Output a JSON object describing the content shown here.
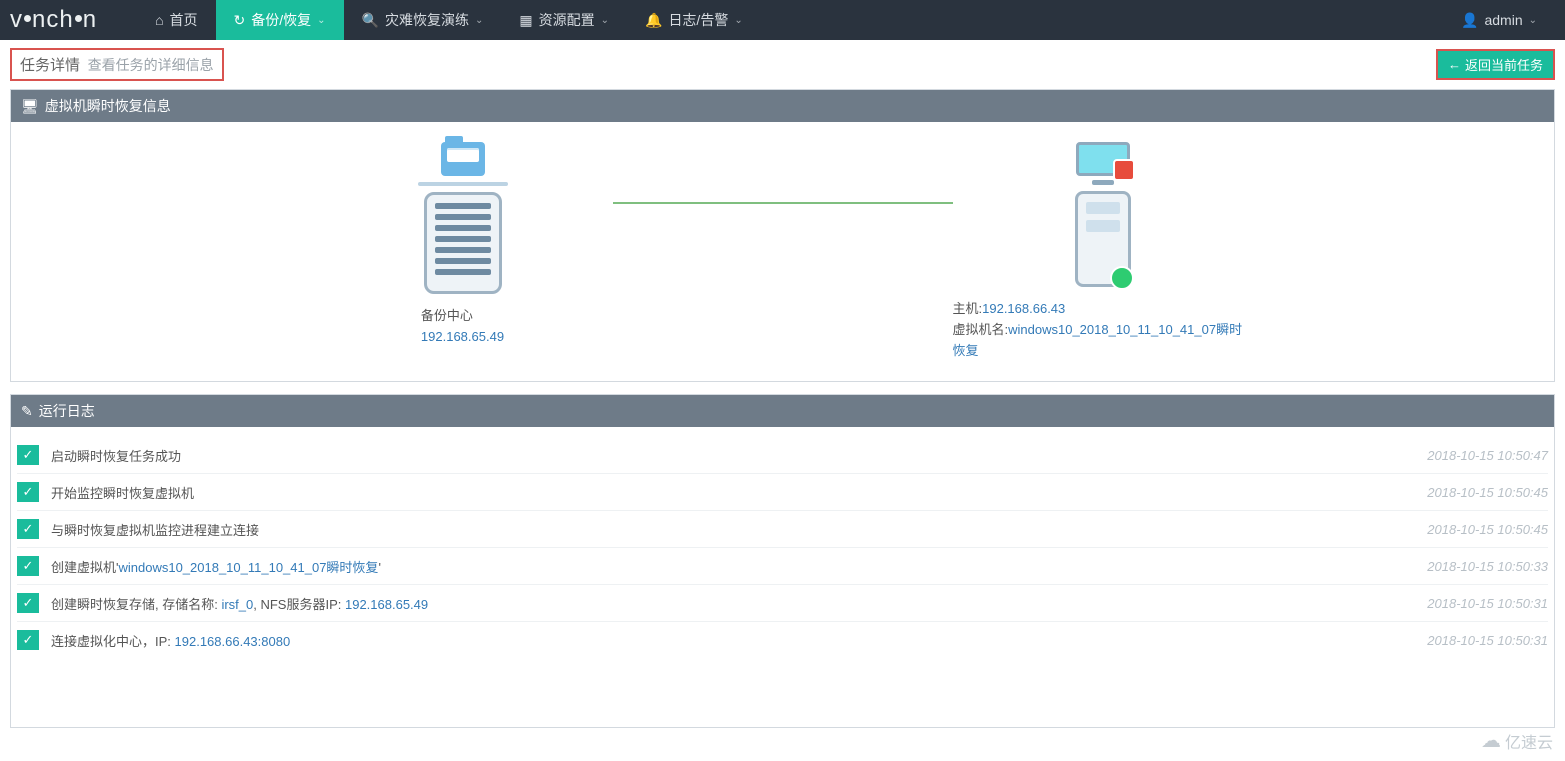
{
  "brand": "vinchin",
  "nav": {
    "items": [
      {
        "icon": "home",
        "label": "首页",
        "has_caret": false,
        "active": false
      },
      {
        "icon": "refresh",
        "label": "备份/恢复",
        "has_caret": true,
        "active": true
      },
      {
        "icon": "search",
        "label": "灾难恢复演练",
        "has_caret": true,
        "active": false
      },
      {
        "icon": "grid",
        "label": "资源配置",
        "has_caret": true,
        "active": false
      },
      {
        "icon": "bell",
        "label": "日志/告警",
        "has_caret": true,
        "active": false
      }
    ],
    "user_icon": "user",
    "user_label": "admin"
  },
  "titlebar": {
    "title": "任务详情",
    "subtitle": "查看任务的详细信息",
    "return_label": "返回当前任务"
  },
  "panel_info": {
    "title": "虚拟机瞬时恢复信息",
    "backup": {
      "caption_label": "备份中心",
      "ip": "192.168.65.49"
    },
    "host": {
      "host_label": "主机:",
      "host_ip": "192.168.66.43",
      "vm_label": "虚拟机名:",
      "vm_name": "windows10_2018_10_11_10_41_07瞬时恢复"
    }
  },
  "panel_log": {
    "title": "运行日志",
    "rows": [
      {
        "msg_parts": [
          {
            "t": "启动瞬时恢复任务成功"
          }
        ],
        "ts": "2018-10-15 10:50:47"
      },
      {
        "msg_parts": [
          {
            "t": "开始监控瞬时恢复虚拟机"
          }
        ],
        "ts": "2018-10-15 10:50:45"
      },
      {
        "msg_parts": [
          {
            "t": "与瞬时恢复虚拟机监控进程建立连接"
          }
        ],
        "ts": "2018-10-15 10:50:45"
      },
      {
        "msg_parts": [
          {
            "t": "创建虚拟机'"
          },
          {
            "t": "windows10_2018_10_11_10_41_07瞬时恢复",
            "link": true
          },
          {
            "t": "'"
          }
        ],
        "ts": "2018-10-15 10:50:33"
      },
      {
        "msg_parts": [
          {
            "t": "创建瞬时恢复存储, 存储名称: "
          },
          {
            "t": "irsf_0",
            "link": true
          },
          {
            "t": ", NFS服务器IP: "
          },
          {
            "t": "192.168.65.49",
            "link": true
          }
        ],
        "ts": "2018-10-15 10:50:31"
      },
      {
        "msg_parts": [
          {
            "t": "连接虚拟化中心，IP: "
          },
          {
            "t": "192.168.66.43:8080",
            "link": true
          }
        ],
        "ts": "2018-10-15 10:50:31"
      }
    ]
  },
  "watermark": "亿速云",
  "icons": {
    "home": "⌂",
    "refresh": "↻",
    "search": "🔍",
    "grid": "▦",
    "bell": "🔔",
    "user": "👤",
    "monitor": "🖥",
    "edit": "✎",
    "arrow_left": "←",
    "check": "✓",
    "cloud": "☁",
    "caret": "⌄"
  }
}
